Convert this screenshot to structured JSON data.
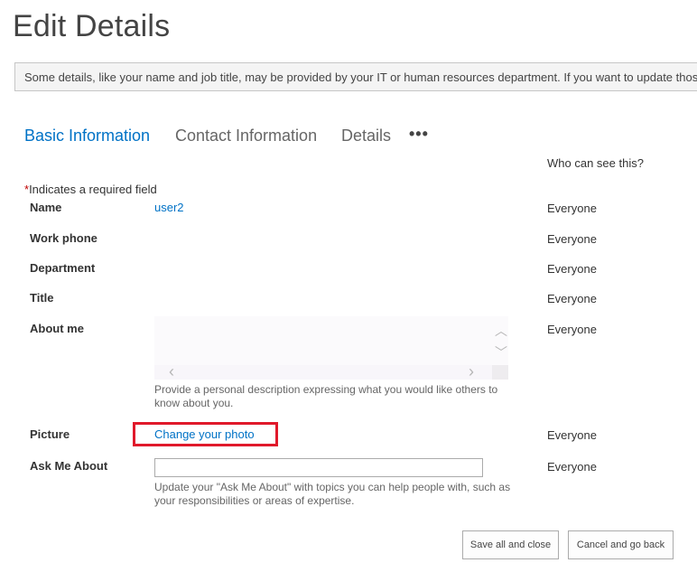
{
  "page": {
    "title": "Edit Details",
    "notice": "Some details, like your name and job title, may be provided by your IT or human resources department. If you want to update those details, contact your administrator."
  },
  "tabs": [
    {
      "label": "Basic Information",
      "active": true
    },
    {
      "label": "Contact Information",
      "active": false
    },
    {
      "label": "Details",
      "active": false
    }
  ],
  "tabs_more_label": "•••",
  "visibility_header": "Who can see this?",
  "required_note": {
    "star": "*",
    "text": "Indicates a required field"
  },
  "fields": {
    "name": {
      "label": "Name",
      "value": "user2",
      "visibility": "Everyone"
    },
    "work_phone": {
      "label": "Work phone",
      "visibility": "Everyone"
    },
    "department": {
      "label": "Department",
      "visibility": "Everyone"
    },
    "title": {
      "label": "Title",
      "visibility": "Everyone"
    },
    "about_me": {
      "label": "About me",
      "visibility": "Everyone",
      "hint": "Provide a personal description expressing what you would like others to know about you."
    },
    "picture": {
      "label": "Picture",
      "link": "Change your photo",
      "visibility": "Everyone"
    },
    "ask_me_about": {
      "label": "Ask Me About",
      "value": "",
      "visibility": "Everyone",
      "hint": "Update your \"Ask Me About\" with topics you can help people with, such as your responsibilities or areas of expertise."
    }
  },
  "scroll_glyphs": {
    "up": "︿",
    "down": "﹀",
    "left": "‹",
    "right": "›"
  },
  "buttons": {
    "save": "Save all and close",
    "cancel": "Cancel and go back"
  },
  "colors": {
    "accent": "#0072c6",
    "highlight_border": "#e0192b",
    "required_star": "#bf0000"
  }
}
